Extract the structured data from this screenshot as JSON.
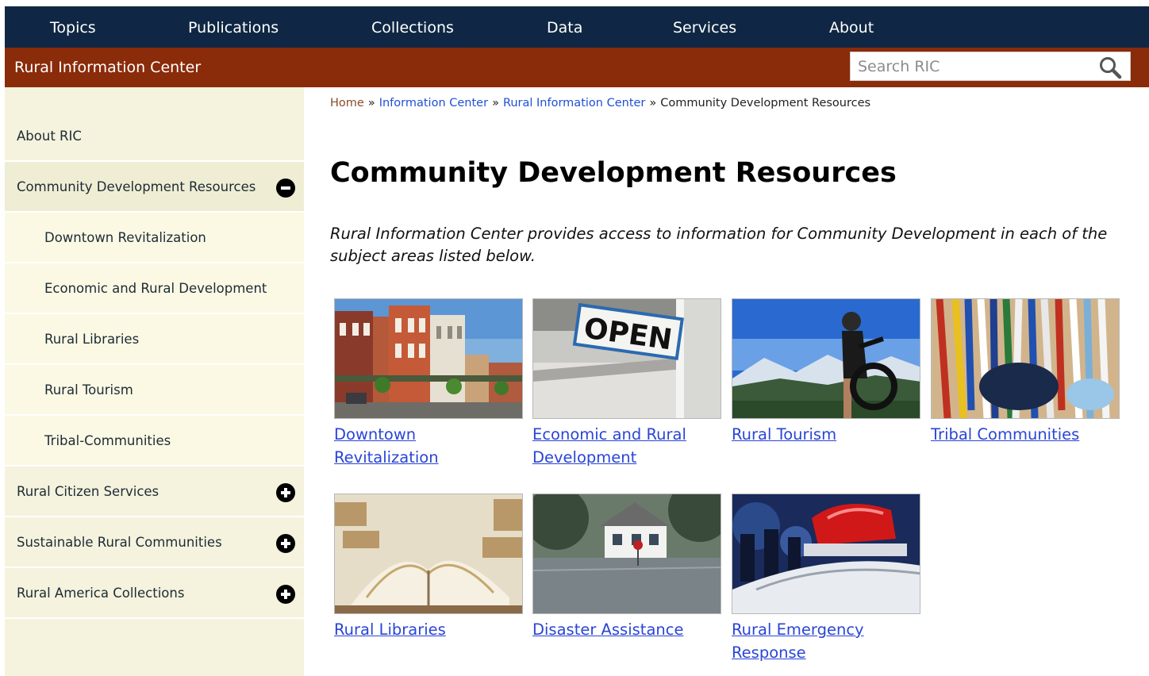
{
  "top_nav": {
    "items": [
      "Topics",
      "Publications",
      "Collections",
      "Data",
      "Services",
      "About"
    ]
  },
  "site": {
    "title": "Rural Information Center",
    "search_placeholder": "Search RIC",
    "search_icon": "magnifier-icon"
  },
  "sidebar": {
    "items": [
      {
        "label": "About RIC",
        "type": "top",
        "toggle": "none"
      },
      {
        "label": "Community Development Resources",
        "type": "top",
        "toggle": "minus-circle-icon"
      },
      {
        "label": "Downtown Revitalization",
        "type": "sub",
        "toggle": "none"
      },
      {
        "label": "Economic and Rural Development",
        "type": "sub",
        "toggle": "none"
      },
      {
        "label": "Rural Libraries",
        "type": "sub",
        "toggle": "none"
      },
      {
        "label": "Rural Tourism",
        "type": "sub",
        "toggle": "none"
      },
      {
        "label": "Tribal-Communities",
        "type": "sub",
        "toggle": "none"
      },
      {
        "label": "Rural Citizen Services",
        "type": "top",
        "toggle": "plus-circle-icon"
      },
      {
        "label": "Sustainable Rural Communities",
        "type": "top",
        "toggle": "plus-circle-icon"
      },
      {
        "label": "Rural America Collections",
        "type": "top",
        "toggle": "plus-circle-icon"
      }
    ]
  },
  "breadcrumb": {
    "items": [
      "Home",
      "Information Center",
      "Rural Information Center"
    ],
    "separator": "»",
    "current": "Community Development Resources"
  },
  "main": {
    "title": "Community Development Resources",
    "intro": "Rural Information Center provides access to information for Community Development in each of the subject areas listed below.",
    "cards": [
      {
        "title": "Downtown Revitalization",
        "image": "downtown-street-photo"
      },
      {
        "title": "Economic and Rural Development",
        "image": "open-sign-photo",
        "image_text": "OPEN"
      },
      {
        "title": "Rural Tourism",
        "image": "mountain-biker-photo"
      },
      {
        "title": "Tribal Communities",
        "image": "tribal-regalia-photo"
      },
      {
        "title": "Rural Libraries",
        "image": "open-books-photo"
      },
      {
        "title": "Disaster Assistance",
        "image": "flooded-house-photo"
      },
      {
        "title": "Rural Emergency Response",
        "image": "police-car-photo"
      }
    ]
  },
  "colors": {
    "top_nav_bg": "#0f2744",
    "site_bar_bg": "#8a2b0a",
    "sidebar_bg": "#f5f3dd",
    "link": "#2a45d6"
  }
}
